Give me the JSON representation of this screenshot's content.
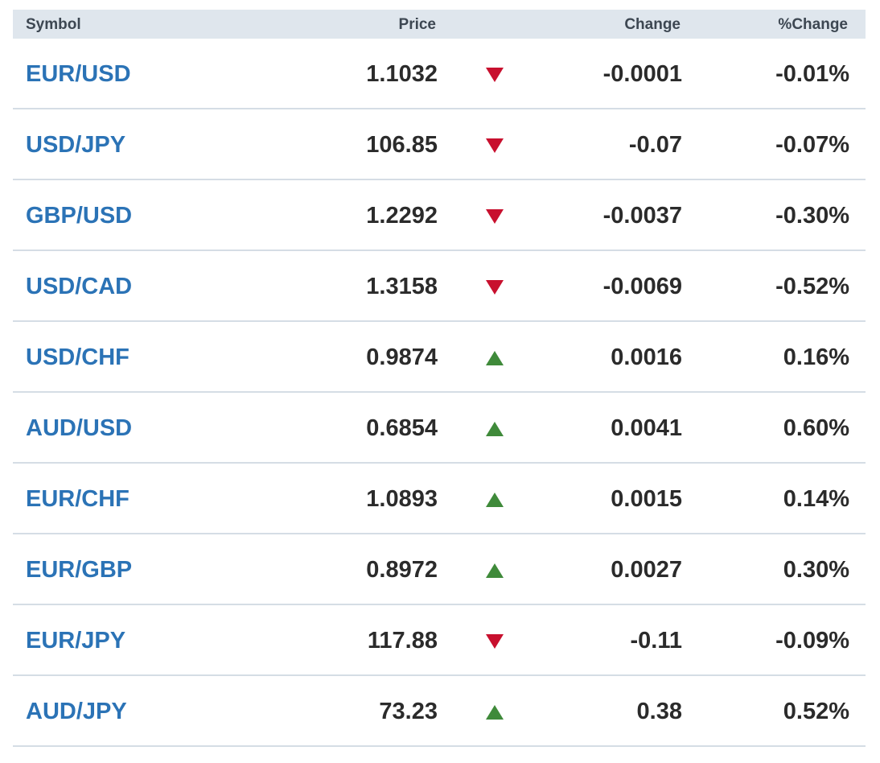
{
  "headers": {
    "symbol": "Symbol",
    "price": "Price",
    "change": "Change",
    "pct_change": "%Change"
  },
  "colors": {
    "up": "#3f8a3a",
    "down": "#c8102e",
    "symbol_link": "#2b73b6",
    "header_bg": "#dfe6ed"
  },
  "rows": [
    {
      "symbol": "EUR/USD",
      "price": "1.1032",
      "direction": "down",
      "change": "-0.0001",
      "pct_change": "-0.01%"
    },
    {
      "symbol": "USD/JPY",
      "price": "106.85",
      "direction": "down",
      "change": "-0.07",
      "pct_change": "-0.07%"
    },
    {
      "symbol": "GBP/USD",
      "price": "1.2292",
      "direction": "down",
      "change": "-0.0037",
      "pct_change": "-0.30%"
    },
    {
      "symbol": "USD/CAD",
      "price": "1.3158",
      "direction": "down",
      "change": "-0.0069",
      "pct_change": "-0.52%"
    },
    {
      "symbol": "USD/CHF",
      "price": "0.9874",
      "direction": "up",
      "change": "0.0016",
      "pct_change": "0.16%"
    },
    {
      "symbol": "AUD/USD",
      "price": "0.6854",
      "direction": "up",
      "change": "0.0041",
      "pct_change": "0.60%"
    },
    {
      "symbol": "EUR/CHF",
      "price": "1.0893",
      "direction": "up",
      "change": "0.0015",
      "pct_change": "0.14%"
    },
    {
      "symbol": "EUR/GBP",
      "price": "0.8972",
      "direction": "up",
      "change": "0.0027",
      "pct_change": "0.30%"
    },
    {
      "symbol": "EUR/JPY",
      "price": "117.88",
      "direction": "down",
      "change": "-0.11",
      "pct_change": "-0.09%"
    },
    {
      "symbol": "AUD/JPY",
      "price": "73.23",
      "direction": "up",
      "change": "0.38",
      "pct_change": "0.52%"
    }
  ]
}
